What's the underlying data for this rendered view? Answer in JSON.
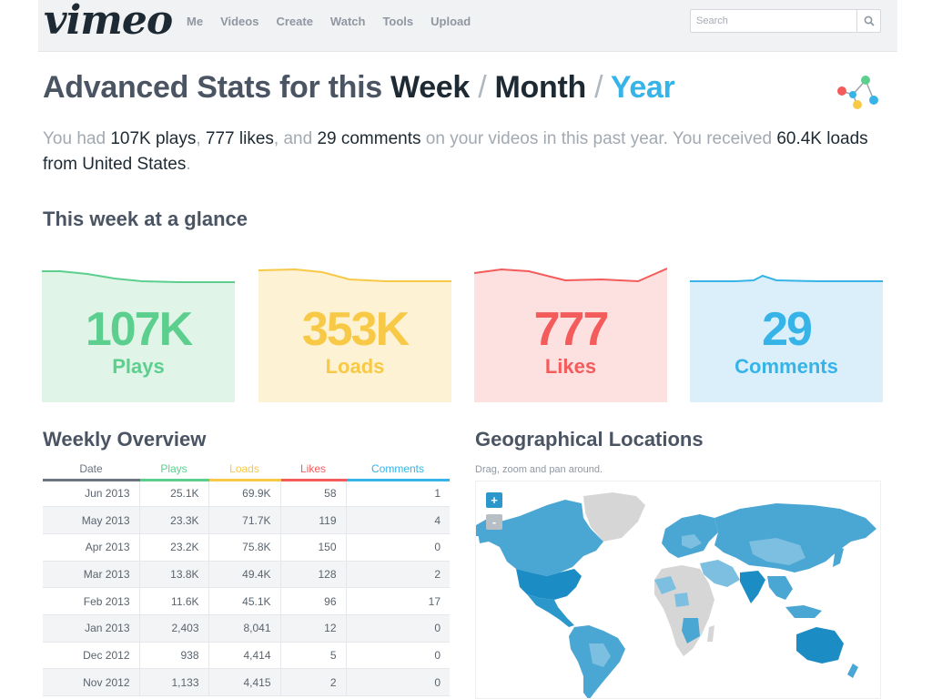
{
  "nav": {
    "logo": "vimeo",
    "items": [
      "Me",
      "Videos",
      "Create",
      "Watch",
      "Tools",
      "Upload"
    ],
    "search_placeholder": "Search"
  },
  "title": {
    "prefix": "Advanced Stats for this",
    "week": "Week",
    "sep1": "/",
    "month": "Month",
    "sep2": "/",
    "year": "Year"
  },
  "summary": {
    "t1": "You had ",
    "plays": "107K plays",
    "t2": ", ",
    "likes": "777 likes",
    "t3": ", and ",
    "comments": "29 comments",
    "t4": " on your videos in this past year. You received ",
    "loads": "60.4K loads from United States",
    "t5": "."
  },
  "glance": {
    "heading": "This week at a glance",
    "cards": [
      {
        "value": "107K",
        "label": "Plays",
        "color": "#5ccf8e",
        "bg": "#e0f5e7"
      },
      {
        "value": "353K",
        "label": "Loads",
        "color": "#f8c946",
        "bg": "#fdf2d3"
      },
      {
        "value": "777",
        "label": "Likes",
        "color": "#f45b5b",
        "bg": "#fde0e0"
      },
      {
        "value": "29",
        "label": "Comments",
        "color": "#36b4e8",
        "bg": "#dbeffb"
      }
    ]
  },
  "overview": {
    "heading": "Weekly Overview",
    "columns": [
      {
        "label": "Date",
        "color": "#6b7480"
      },
      {
        "label": "Plays",
        "color": "#5ccf8e"
      },
      {
        "label": "Loads",
        "color": "#f8c946"
      },
      {
        "label": "Likes",
        "color": "#f45b5b"
      },
      {
        "label": "Comments",
        "color": "#36b4e8"
      }
    ],
    "rows": [
      [
        "Jun 2013",
        "25.1K",
        "69.9K",
        "58",
        "1"
      ],
      [
        "May 2013",
        "23.3K",
        "71.7K",
        "119",
        "4"
      ],
      [
        "Apr 2013",
        "23.2K",
        "75.8K",
        "150",
        "0"
      ],
      [
        "Mar 2013",
        "13.8K",
        "49.4K",
        "128",
        "2"
      ],
      [
        "Feb 2013",
        "11.6K",
        "45.1K",
        "96",
        "17"
      ],
      [
        "Jan 2013",
        "2,403",
        "8,041",
        "12",
        "0"
      ],
      [
        "Dec 2012",
        "938",
        "4,414",
        "5",
        "0"
      ],
      [
        "Nov 2012",
        "1,133",
        "4,415",
        "2",
        "0"
      ]
    ]
  },
  "geo": {
    "heading": "Geographical Locations",
    "subtitle": "Drag, zoom and pan around.",
    "zoom_in": "+",
    "zoom_out": "-"
  }
}
